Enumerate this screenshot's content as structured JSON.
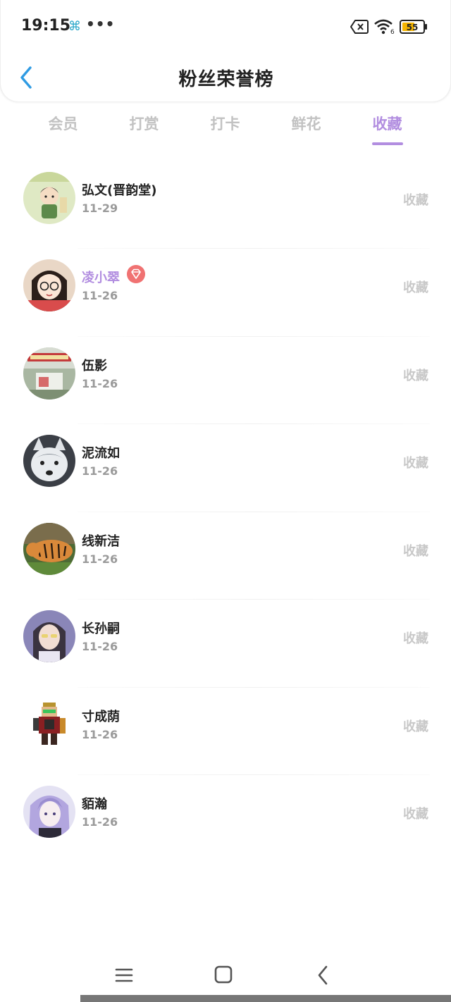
{
  "status_bar": {
    "time": "19:15",
    "more": "•••",
    "battery_level": "55",
    "wifi_signal_label": "6"
  },
  "header": {
    "title": "粉丝荣誉榜"
  },
  "tabs": [
    {
      "label": "会员",
      "active": false
    },
    {
      "label": "打赏",
      "active": false
    },
    {
      "label": "打卡",
      "active": false
    },
    {
      "label": "鲜花",
      "active": false
    },
    {
      "label": "收藏",
      "active": true
    }
  ],
  "fans": [
    {
      "name": "弘文(晋韵堂)",
      "date": "11-29",
      "type": "收藏",
      "vip": false,
      "avatar": "avatar-ink-painting-boy"
    },
    {
      "name": "凌小翠",
      "date": "11-26",
      "type": "收藏",
      "vip": true,
      "avatar": "avatar-cartoon-girl-glasses"
    },
    {
      "name": "伍影",
      "date": "11-26",
      "type": "收藏",
      "vip": false,
      "avatar": "avatar-photo-banner"
    },
    {
      "name": "泥流如",
      "date": "11-26",
      "type": "收藏",
      "vip": false,
      "avatar": "avatar-husky-dog"
    },
    {
      "name": "线新洁",
      "date": "11-26",
      "type": "收藏",
      "vip": false,
      "avatar": "avatar-tiger"
    },
    {
      "name": "长孙嗣",
      "date": "11-26",
      "type": "收藏",
      "vip": false,
      "avatar": "avatar-anime-boy"
    },
    {
      "name": "寸成荫",
      "date": "11-26",
      "type": "收藏",
      "vip": false,
      "avatar": "avatar-pixel-warrior"
    },
    {
      "name": "貊瀚",
      "date": "11-26",
      "type": "收藏",
      "vip": false,
      "avatar": "avatar-anime-purple-hair"
    }
  ],
  "colors": {
    "accent": "#b28ee0",
    "back_arrow": "#2f9be3",
    "vip_badge": "#f07272",
    "tab_inactive": "#c2c2c2",
    "date_gray": "#9a9a9a",
    "type_gray": "#c8c8c8",
    "battery_fill": "#f4b400"
  },
  "icons": {
    "back": "chevron-left-icon",
    "vip": "diamond-badge-icon",
    "nav_menu": "menu-lines-icon",
    "nav_home": "square-home-icon",
    "nav_back": "chevron-back-icon"
  }
}
